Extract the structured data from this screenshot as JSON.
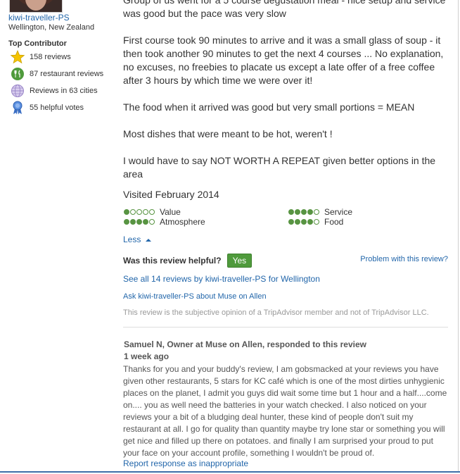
{
  "reviewer": {
    "username": "kiwi-traveller-PS",
    "location": "Wellington, New Zealand",
    "badge": "Top Contributor",
    "stats": [
      {
        "icon": "star-icon",
        "label": "158 reviews"
      },
      {
        "icon": "fork-knife-icon",
        "label": "87 restaurant reviews"
      },
      {
        "icon": "globe-icon",
        "label": "Reviews in 63 cities"
      },
      {
        "icon": "ribbon-icon",
        "label": "55 helpful votes"
      }
    ]
  },
  "review": {
    "paragraphs": [
      "Group of us went for a 5 course degustation meal - nice setup and service was good but the pace was very slow",
      "First course took 90 minutes to arrive and it was a small glass of soup - it then took another 90 minutes to get the next 4 courses ... No explanation, no excuses, no freebies to placate us except a late offer of a free coffee after 3 hours by which time we were over it!",
      "The food when it arrived was good but very small portions = MEAN",
      "Most dishes that were meant to be hot, weren't !",
      "I would have to say NOT WORTH A REPEAT given better options in the area"
    ],
    "visited": "Visited February 2014",
    "ratings": [
      {
        "label": "Value",
        "value": 1
      },
      {
        "label": "Service",
        "value": 4
      },
      {
        "label": "Atmosphere",
        "value": 4
      },
      {
        "label": "Food",
        "value": 4
      }
    ],
    "less_label": "Less",
    "helpful_question": "Was this review helpful?",
    "yes_label": "Yes",
    "problem_link": "Problem with this review?",
    "see_all_link": "See all 14 reviews by kiwi-traveller-PS for Wellington",
    "ask_link": "Ask kiwi-traveller-PS about Muse on Allen",
    "disclaimer": "This review is the subjective opinion of a TripAdvisor member and not of TripAdvisor LLC."
  },
  "response": {
    "title": "Samuel N, Owner at Muse on Allen, responded to this review",
    "date": "1 week ago",
    "body": "Thanks for you and your buddy's review, I am gobsmacked at your reviews you have given other restaurants, 5 stars for KC café which is one of the most dirties unhygienic places on the planet, I admit you guys did wait some time but 1 hour and a half....come on.... you as well need the batteries in your watch checked. I also noticed on your reviews your a bit of a bludging deal hunter, these kind of people don't suit my restaurant at all. I go for quality than quantity maybe try lone star or something you will get nice and filled up there on potatoes. and finally I am surprised your proud to put your face on your account profile, something I wouldn't be proud of.",
    "report_link": "Report response as inappropriate"
  }
}
